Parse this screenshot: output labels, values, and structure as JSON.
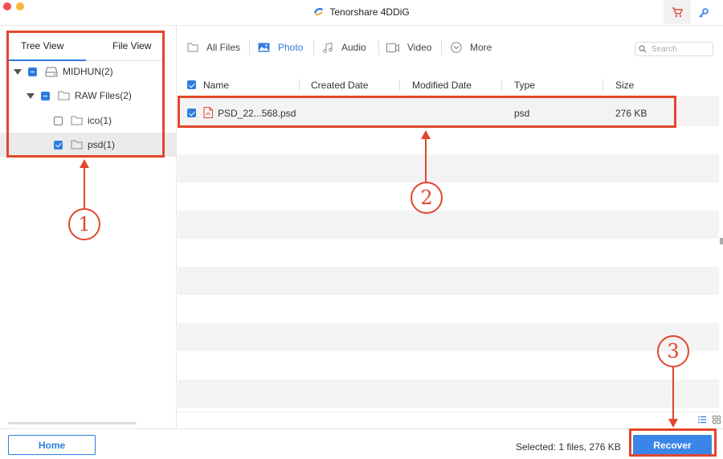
{
  "window": {
    "title": "Tenorshare 4DDiG",
    "accent_color": "#2f7de1",
    "annotation_color": "#e2462d"
  },
  "sidebar": {
    "tabs": [
      {
        "label": "Tree View",
        "active": true
      },
      {
        "label": "File View",
        "active": false
      }
    ],
    "tree": [
      {
        "label": "MIDHUN(2)",
        "icon": "drive-icon",
        "state": "partial",
        "expanded": true
      },
      {
        "label": "RAW Files(2)",
        "icon": "folder-icon",
        "state": "partial",
        "expanded": true
      },
      {
        "label": "ico(1)",
        "icon": "folder-icon",
        "state": "unchecked"
      },
      {
        "label": "psd(1)",
        "icon": "folder-icon",
        "state": "checked",
        "selected": true
      }
    ]
  },
  "filters": {
    "items": [
      {
        "label": "All Files",
        "icon": "folder-icon",
        "active": false
      },
      {
        "label": "Photo",
        "icon": "image-icon",
        "active": true
      },
      {
        "label": "Audio",
        "icon": "music-icon",
        "active": false
      },
      {
        "label": "Video",
        "icon": "video-icon",
        "active": false
      },
      {
        "label": "More",
        "icon": "chevron-circle-icon",
        "active": false
      }
    ],
    "search_placeholder": "Search"
  },
  "table": {
    "columns": [
      "Name",
      "Created Date",
      "Modified Date",
      "Type",
      "Size"
    ],
    "rows": [
      {
        "name": "PSD_22...568.psd",
        "created": "",
        "modified": "",
        "type": "psd",
        "size": "276 KB",
        "checked": true
      }
    ]
  },
  "footer": {
    "home_label": "Home",
    "status": "Selected: 1 files, 276 KB",
    "recover_label": "Recover"
  },
  "annotations": [
    "1",
    "2",
    "3"
  ]
}
